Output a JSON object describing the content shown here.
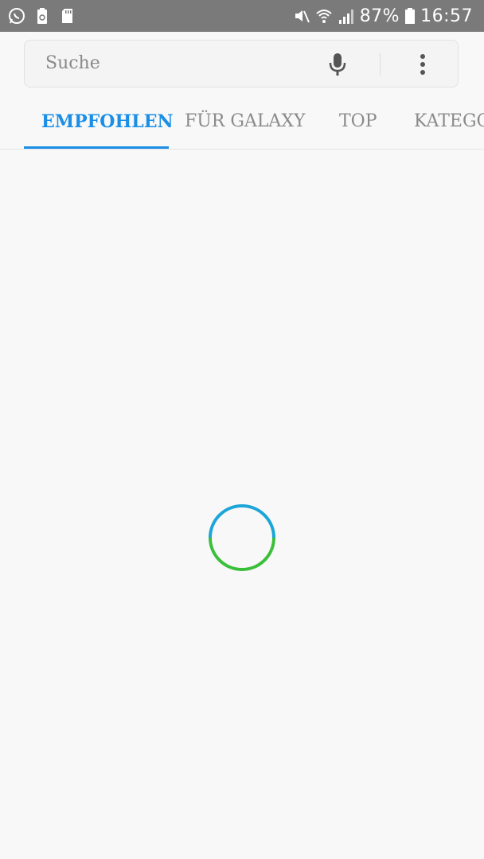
{
  "status_bar": {
    "battery_percent": "87%",
    "time": "16:57",
    "icons": [
      "whatsapp-icon",
      "recycle-battery-icon",
      "sd-card-icon",
      "mute-icon",
      "wifi-icon",
      "signal-icon",
      "battery-icon"
    ]
  },
  "search": {
    "placeholder": "Suche",
    "mic_icon": "mic-icon",
    "more_icon": "more-vert-icon"
  },
  "tabs": [
    {
      "label": "EMPFOHLEN",
      "active": true
    },
    {
      "label": "FÜR GALAXY",
      "active": false
    },
    {
      "label": "TOP",
      "active": false
    },
    {
      "label": "KATEGO",
      "active": false
    }
  ],
  "colors": {
    "status_bar_bg": "#7a7a7a",
    "accent": "#1b8fe6",
    "spinner_blue": "#1ba5d8",
    "spinner_green": "#3bbf3b",
    "background": "#f8f8f8"
  },
  "loading": {
    "indicator": "loading-spinner"
  }
}
